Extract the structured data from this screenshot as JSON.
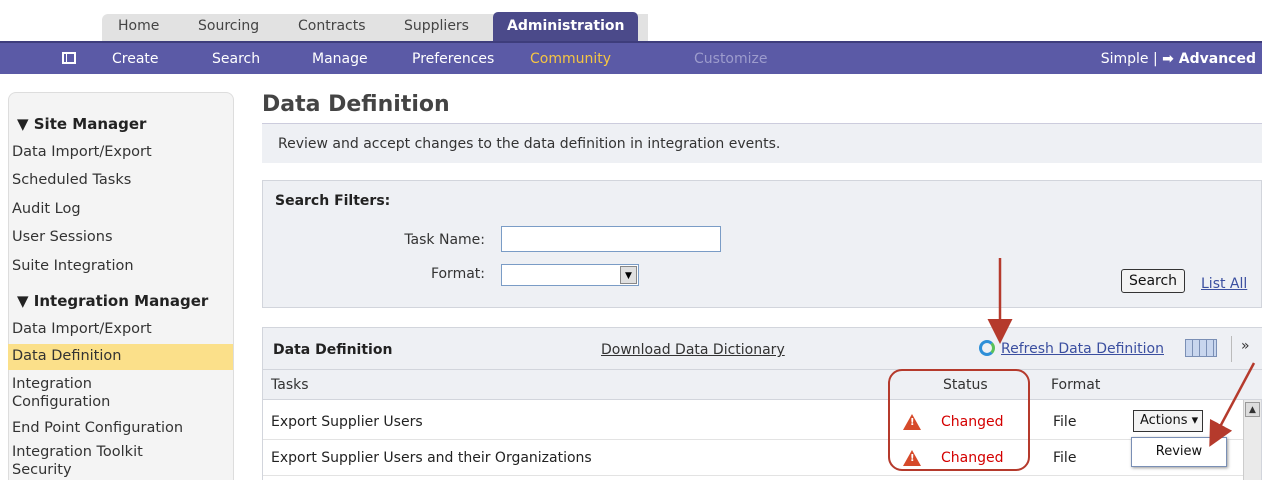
{
  "top_tabs": [
    "Home",
    "Sourcing",
    "Contracts",
    "Suppliers",
    "Administration"
  ],
  "active_tab": "Administration",
  "nav": {
    "create": "Create",
    "search": "Search",
    "manage": "Manage",
    "preferences": "Preferences",
    "community": "Community",
    "customize": "Customize",
    "mode_simple": "Simple",
    "mode_sep": "|",
    "mode_advanced": "➡ Advanced"
  },
  "sidebar": {
    "site_manager": {
      "title": "▼ Site Manager",
      "items": [
        "Data Import/Export",
        "Scheduled Tasks",
        "Audit Log",
        "User Sessions",
        "Suite Integration"
      ]
    },
    "integration_manager": {
      "title": "▼ Integration Manager",
      "items": [
        "Data Import/Export",
        "Data Definition",
        "Integration Configuration",
        "End Point Configuration",
        "Integration Toolkit Security"
      ]
    },
    "selected": "Data Definition"
  },
  "page": {
    "title": "Data Definition",
    "description": "Review and accept changes to the data definition in integration events."
  },
  "filters": {
    "title": "Search Filters:",
    "task_name_label": "Task Name:",
    "task_name_value": "",
    "format_label": "Format:",
    "format_value": "",
    "search_button": "Search",
    "list_all": "List All"
  },
  "grid": {
    "title": "Data Definition",
    "download_link": "Download Data Dictionary",
    "refresh_link": "Refresh Data Definition",
    "columns": {
      "tasks": "Tasks",
      "status": "Status",
      "format": "Format"
    },
    "rows": [
      {
        "task": "Export Supplier Users",
        "status": "Changed",
        "format": "File",
        "action": "Actions ▾"
      },
      {
        "task": "Export Supplier Users and their Organizations",
        "status": "Changed",
        "format": "File"
      }
    ],
    "menu_item": "Review"
  },
  "colors": {
    "nav_bg": "#5b5aa6",
    "active_tab_bg": "#4b4a8a",
    "highlight": "#f5c542",
    "status_red": "#d40000",
    "annotation": "#b53a2c"
  }
}
